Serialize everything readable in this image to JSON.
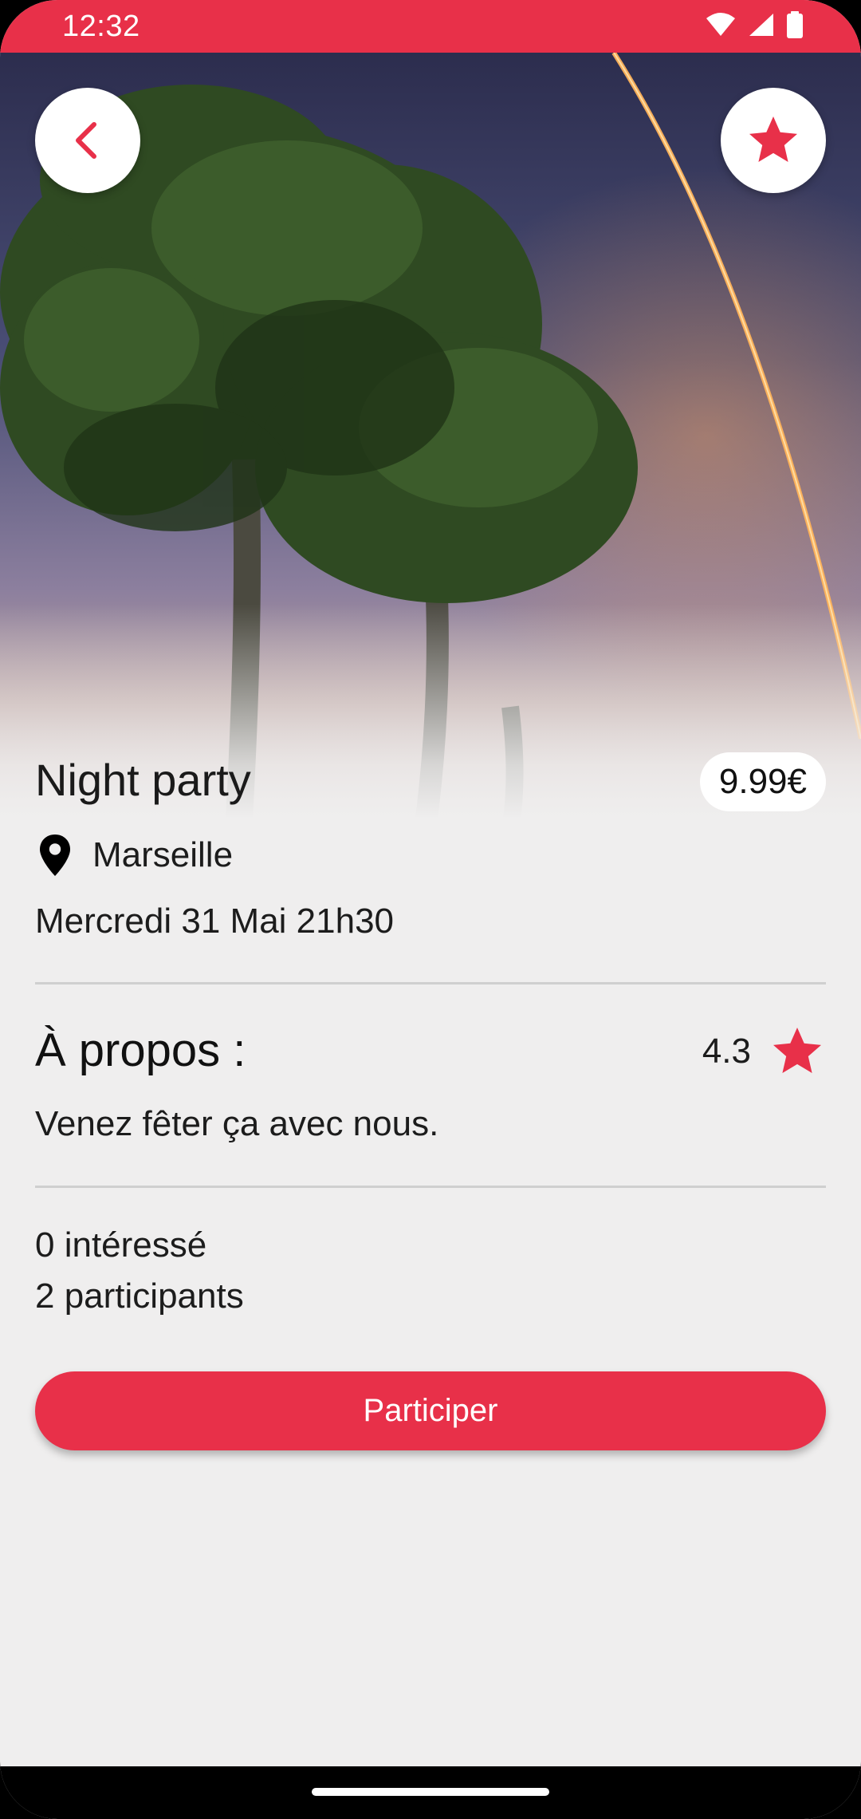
{
  "status_bar": {
    "time": "12:32"
  },
  "event": {
    "title": "Night party",
    "price": "9.99€",
    "location": "Marseille",
    "date": "Mercredi 31 Mai 21h30"
  },
  "about": {
    "heading": "À propos :",
    "rating": "4.3",
    "description": "Venez fêter ça avec nous."
  },
  "stats": {
    "interested": "0 intéressé",
    "participants": "2 participants"
  },
  "actions": {
    "participate_label": "Participer"
  },
  "icons": {
    "back": "chevron-left-icon",
    "favorite": "star-icon",
    "location": "map-pin-icon",
    "rating": "star-icon"
  },
  "colors": {
    "accent": "#e83049",
    "background": "#efeeee",
    "price_badge": "#ffffff"
  }
}
